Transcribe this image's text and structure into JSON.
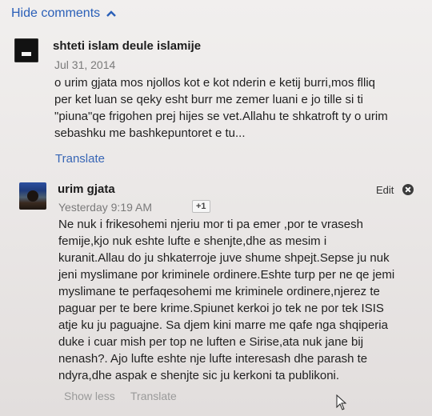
{
  "header": {
    "hide_comments_label": "Hide comments",
    "chevron_icon": "chevron-up-icon"
  },
  "comments": [
    {
      "author": "shteti islam deule islamije",
      "avatar_icon": "dark-avatar",
      "date": "Jul 31, 2014",
      "lines": [
        "o urim gjata mos njollos kot e kot nderin e ketij burri,mos flliq",
        "per ket luan se qeky esht burr me zemer luani e jo tille si ti",
        "\"piuna\"qe frigohen prej hijes se vet.Allahu te shkatroft ty o urim",
        "sebashku me bashkepuntoret e tu..."
      ],
      "translate_label": "Translate"
    },
    {
      "author": "urim gjata",
      "avatar_icon": "photo-avatar",
      "date": "Yesterday 9:19 AM",
      "plus_one_label": "+1",
      "edit_label": "Edit",
      "close_icon": "close-icon",
      "lines": [
        "Ne nuk i frikesohemi njeriu mor ti pa emer ,por te vrasesh",
        "femije,kjo nuk eshte lufte e shenjte,dhe as mesim i",
        "kuranit.Allau do ju shkaterroje juve  shume shpejt.Sepse ju nuk",
        "jeni myslimane por kriminele ordinere.Eshte turp per ne qe jemi",
        "myslimane te perfaqesohemi me kriminele ordinere,njerez te",
        "paguar per te bere krime.Spiunet kerkoi jo tek ne por tek ISIS",
        "atje ku ju paguajne. Sa djem kini marre me qafe nga shqiperia",
        "duke i cuar mish per top ne luften e Sirise,ata nuk jane bij",
        "nenash?. Ajo lufte eshte nje lufte interesash dhe parash te",
        "ndyra,dhe aspak e shenjte sic ju kerkoni ta publikoni."
      ],
      "show_less_label": "Show less",
      "translate_label": "Translate"
    }
  ],
  "colors": {
    "link": "#3866b5",
    "header_link": "#2a5fb8",
    "muted": "#7a7a7a"
  }
}
